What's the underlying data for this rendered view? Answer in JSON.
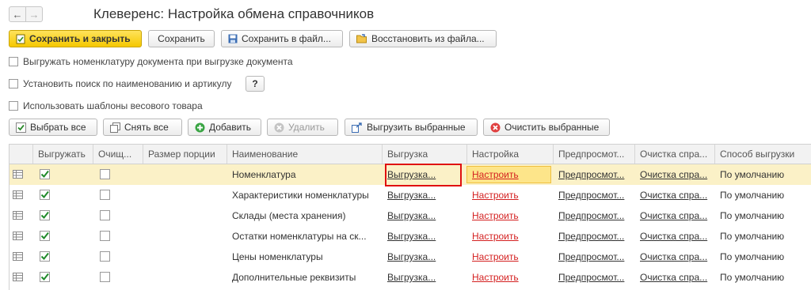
{
  "window": {
    "title": "Клеверенс: Настройка обмена справочников",
    "back": "←",
    "forward": "→"
  },
  "toolbar": {
    "save_close": "Сохранить и закрыть",
    "save": "Сохранить",
    "save_to_file": "Сохранить в файл...",
    "restore_from_file": "Восстановить из файла..."
  },
  "options": {
    "export_doc_items": "Выгружать номенклатуру документа при выгрузке документа",
    "search_by_name": "Установить поиск по наименованию и артикулу",
    "help": "?",
    "weight_templates": "Использовать шаблоны весового товара"
  },
  "grid_toolbar": {
    "select_all": "Выбрать все",
    "deselect_all": "Снять все",
    "add": "Добавить",
    "delete": "Удалить",
    "export_selected": "Выгрузить выбранные",
    "clear_selected": "Очистить выбранные"
  },
  "columns": [
    "Выгружать",
    "Очищ...",
    "Размер порции",
    "Наименование",
    "Выгрузка",
    "Настройка",
    "Предпросмот...",
    "Очистка спра...",
    "Способ выгрузки"
  ],
  "rows": [
    {
      "export": true,
      "clear": false,
      "portion": "",
      "name": "Номенклатура",
      "upload": "Выгрузка...",
      "settings": "Настроить",
      "preview": "Предпросмот...",
      "cleanup": "Очистка спра...",
      "method": "По умолчанию",
      "selected": true
    },
    {
      "export": true,
      "clear": false,
      "portion": "",
      "name": "Характеристики номенклатуры",
      "upload": "Выгрузка...",
      "settings": "Настроить",
      "preview": "Предпросмот...",
      "cleanup": "Очистка спра...",
      "method": "По умолчанию",
      "selected": false
    },
    {
      "export": true,
      "clear": false,
      "portion": "",
      "name": "Склады (места хранения)",
      "upload": "Выгрузка...",
      "settings": "Настроить",
      "preview": "Предпросмот...",
      "cleanup": "Очистка спра...",
      "method": "По умолчанию",
      "selected": false
    },
    {
      "export": true,
      "clear": false,
      "portion": "",
      "name": "Остатки номенклатуры на ск...",
      "upload": "Выгрузка...",
      "settings": "Настроить",
      "preview": "Предпросмот...",
      "cleanup": "Очистка спра...",
      "method": "По умолчанию",
      "selected": false
    },
    {
      "export": true,
      "clear": false,
      "portion": "",
      "name": "Цены номенклатуры",
      "upload": "Выгрузка...",
      "settings": "Настроить",
      "preview": "Предпросмот...",
      "cleanup": "Очистка спра...",
      "method": "По умолчанию",
      "selected": false
    },
    {
      "export": true,
      "clear": false,
      "portion": "",
      "name": "Дополнительные реквизиты",
      "upload": "Выгрузка...",
      "settings": "Настроить",
      "preview": "Предпросмот...",
      "cleanup": "Очистка спра...",
      "method": "По умолчанию",
      "selected": false
    }
  ]
}
